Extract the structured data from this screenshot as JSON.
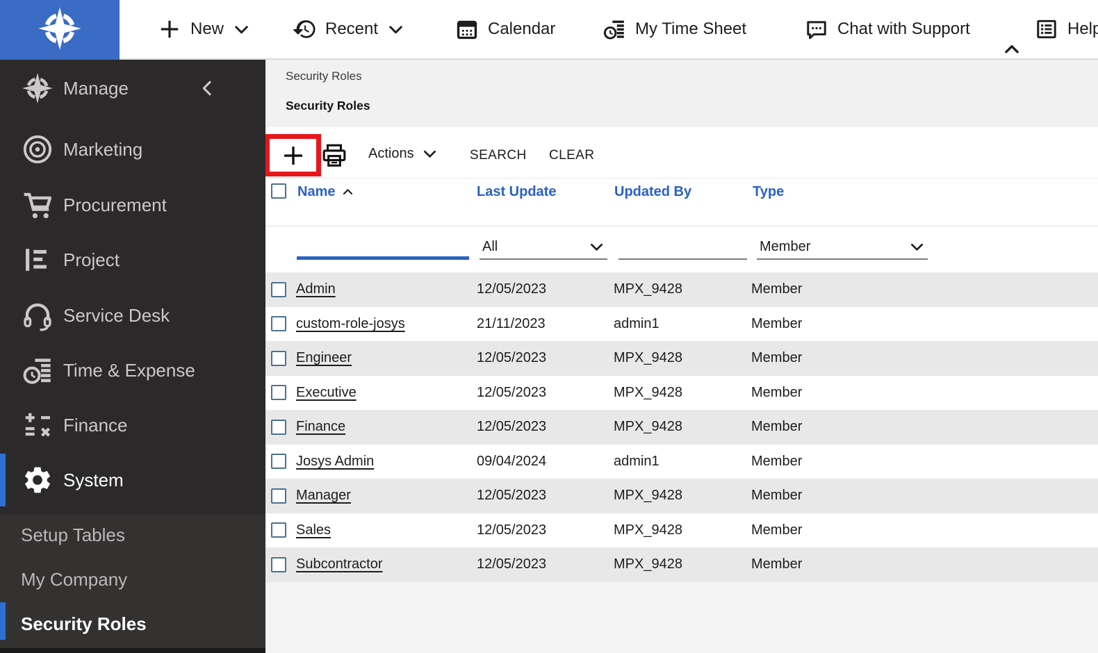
{
  "topbar": {
    "logo_icon": "compass-icon",
    "items": [
      {
        "label": "New",
        "icon": "plus-icon",
        "chevron": true
      },
      {
        "label": "Recent",
        "icon": "history-icon",
        "chevron": true
      },
      {
        "label": "Calendar",
        "icon": "calendar-icon",
        "chevron": false
      },
      {
        "label": "My Time Sheet",
        "icon": "timesheet-icon",
        "chevron": false
      },
      {
        "label": "Chat with Support",
        "icon": "chat-icon",
        "chevron": false
      },
      {
        "label": "Help",
        "icon": "help-list-icon",
        "chevron": false
      }
    ],
    "collapse_icon": "chevron-up-icon"
  },
  "sidebar": {
    "items": [
      {
        "label": "Manage",
        "icon": "compass-icon",
        "collapse": true,
        "active": false
      },
      {
        "label": "Marketing",
        "icon": "target-icon",
        "collapse": false,
        "active": false
      },
      {
        "label": "Procurement",
        "icon": "cart-icon",
        "collapse": false,
        "active": false
      },
      {
        "label": "Project",
        "icon": "list-tree-icon",
        "collapse": false,
        "active": false
      },
      {
        "label": "Service Desk",
        "icon": "headset-icon",
        "collapse": false,
        "active": false
      },
      {
        "label": "Time & Expense",
        "icon": "clock-list-icon",
        "collapse": false,
        "active": false
      },
      {
        "label": "Finance",
        "icon": "calculator-icon",
        "collapse": false,
        "active": false
      },
      {
        "label": "System",
        "icon": "gear-icon",
        "collapse": false,
        "active": true
      }
    ],
    "subitems": [
      {
        "label": "Setup Tables",
        "active": false
      },
      {
        "label": "My Company",
        "active": false
      },
      {
        "label": "Security Roles",
        "active": true
      }
    ]
  },
  "page": {
    "breadcrumb": "Security Roles",
    "title": "Security Roles",
    "toolbar": {
      "actions_label": "Actions",
      "search_label": "SEARCH",
      "clear_label": "CLEAR"
    },
    "table": {
      "columns": [
        "Name",
        "Last Update",
        "Updated By",
        "Type"
      ],
      "sort_column": "Name",
      "sort_direction": "asc",
      "filters": {
        "name_value": "",
        "last_update_value": "All",
        "updated_by_value": "",
        "type_value": "Member"
      },
      "rows": [
        {
          "name": "Admin",
          "last_update": "12/05/2023",
          "updated_by": "MPX_9428",
          "type": "Member"
        },
        {
          "name": "custom-role-josys",
          "last_update": "21/11/2023",
          "updated_by": "admin1",
          "type": "Member"
        },
        {
          "name": "Engineer",
          "last_update": "12/05/2023",
          "updated_by": "MPX_9428",
          "type": "Member"
        },
        {
          "name": "Executive",
          "last_update": "12/05/2023",
          "updated_by": "MPX_9428",
          "type": "Member"
        },
        {
          "name": "Finance",
          "last_update": "12/05/2023",
          "updated_by": "MPX_9428",
          "type": "Member"
        },
        {
          "name": "Josys Admin",
          "last_update": "09/04/2024",
          "updated_by": "admin1",
          "type": "Member"
        },
        {
          "name": "Manager",
          "last_update": "12/05/2023",
          "updated_by": "MPX_9428",
          "type": "Member"
        },
        {
          "name": "Sales",
          "last_update": "12/05/2023",
          "updated_by": "MPX_9428",
          "type": "Member"
        },
        {
          "name": "Subcontractor",
          "last_update": "12/05/2023",
          "updated_by": "MPX_9428",
          "type": "Member"
        }
      ]
    }
  },
  "colors": {
    "brand_blue": "#3a6cc5",
    "accent_blue": "#2b63c4",
    "active_bar_blue": "#2e6fd4",
    "header_link_blue": "#2a61c6",
    "annotation_red": "#e7161b",
    "sidebar_bg": "#2b2929",
    "submenu_bg": "#343131",
    "row_alt_gray": "#e8e8e8",
    "page_header_gray": "#f1f1f1"
  }
}
